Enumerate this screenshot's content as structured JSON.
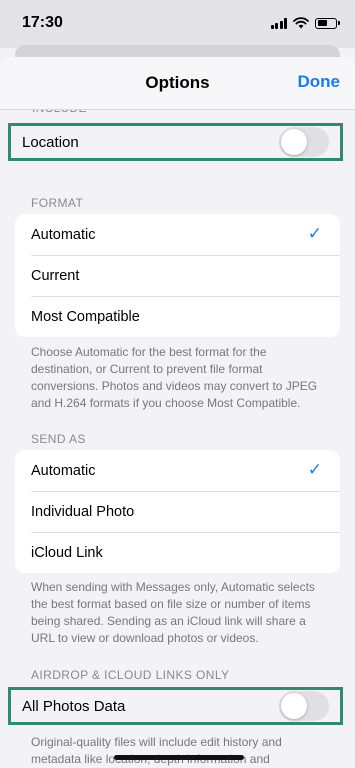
{
  "status": {
    "time": "17:30"
  },
  "nav": {
    "title": "Options",
    "done_label": "Done"
  },
  "top_section": {
    "clipped_header": "INCLUDE",
    "location_label": "Location",
    "location_on": false
  },
  "format": {
    "header": "FORMAT",
    "options": [
      "Automatic",
      "Current",
      "Most Compatible"
    ],
    "selected": "Automatic",
    "footer": "Choose Automatic for the best format for the destination, or Current to prevent file format conversions. Photos and videos may convert to JPEG and H.264 formats if you choose Most Compatible."
  },
  "send_as": {
    "header": "SEND AS",
    "options": [
      "Automatic",
      "Individual Photo",
      "iCloud Link"
    ],
    "selected": "Automatic",
    "footer": "When sending with Messages only, Automatic selects the best format based on file size or number of items being shared. Sending as an iCloud link will share a URL to view or download photos or videos."
  },
  "airdrop": {
    "header": "AIRDROP & ICLOUD LINKS ONLY",
    "all_photos_label": "All Photos Data",
    "all_photos_on": false,
    "footer": "Original-quality files will include edit history and metadata like location, depth information and"
  },
  "colors": {
    "accent": "#1a7cf5",
    "highlight": "#2e8b6f"
  },
  "icons": {
    "check": "checkmark-icon",
    "signal": "cellular-signal-icon",
    "wifi": "wifi-icon",
    "battery": "battery-icon"
  }
}
